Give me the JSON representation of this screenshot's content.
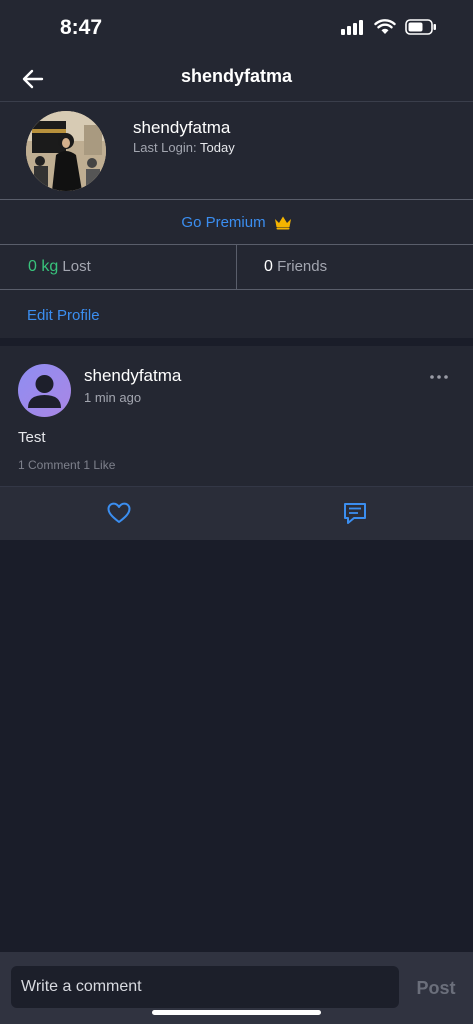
{
  "status_bar": {
    "time": "8:47",
    "icons": [
      "signal-icon",
      "wifi-icon",
      "battery-icon"
    ]
  },
  "header": {
    "title": "shendyfatma",
    "back_icon": "arrow-left-icon"
  },
  "profile": {
    "name": "shendyfatma",
    "last_login_label": "Last Login:",
    "last_login_value": "Today",
    "premium_label": "Go Premium",
    "premium_icon": "crown-icon",
    "stats": {
      "lost_value": "0 kg",
      "lost_label": "Lost",
      "friends_value": "0",
      "friends_label": "Friends"
    },
    "edit_label": "Edit Profile"
  },
  "post": {
    "author": "shendyfatma",
    "time": "1 min ago",
    "text": "Test",
    "meta": "1 Comment 1 Like",
    "actions": [
      "heart-icon",
      "comment-icon"
    ]
  },
  "comment_bar": {
    "placeholder": "Write a comment",
    "submit_label": "Post"
  },
  "colors": {
    "background": "#1a1d29",
    "card": "#242732",
    "accent_blue": "#3b8ef0",
    "green": "#38c37c",
    "crown": "#f4b400"
  }
}
